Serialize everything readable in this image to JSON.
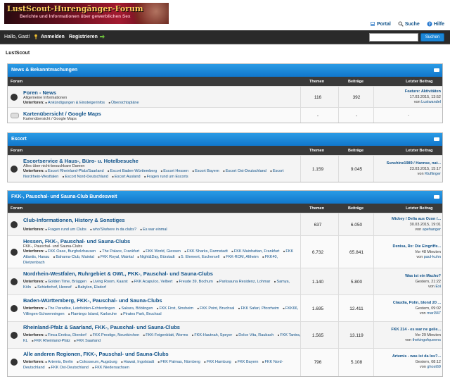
{
  "logo": {
    "title": "LustScout-Hurengänger-Forum",
    "subtitle": "Berichte und Informationen über gewerblichen Sex"
  },
  "toplinks": [
    {
      "label": "Portal",
      "icon": "portal-icon"
    },
    {
      "label": "Suche",
      "icon": "search-icon"
    },
    {
      "label": "Hilfe",
      "icon": "help-icon"
    }
  ],
  "nav": {
    "hello": "Hallo, Gast!",
    "login": "Anmelden",
    "register": "Registrieren",
    "search_btn": "Suchen",
    "search_value": ""
  },
  "site_label": "LustScout",
  "columns": {
    "forum": "Forum",
    "themen": "Themen",
    "beitraege": "Beiträge",
    "letzter": "Letzter Beitrag"
  },
  "categories": [
    {
      "title": "News & Bekanntmachungen",
      "forums": [
        {
          "title": "Foren - News",
          "desc": "Allgemeine Informationen",
          "subs_label": "Unterforen:",
          "subs": [
            "Ankündigungen & Einsteigerinfos",
            "Übersichtspläne"
          ],
          "themen": "116",
          "beitraege": "392",
          "last_title": "Feature: Aktivitäten",
          "last_date": "17.03.2015, 13:52",
          "last_by": "von",
          "last_user": "Lustwandel"
        },
        {
          "title": "Kartenübersicht / Google Maps",
          "desc": "Kartenübersicht / Google Maps",
          "subs_label": "",
          "subs": [],
          "themen": "-",
          "beitraege": "-",
          "last_title": "",
          "last_date": "-",
          "last_by": "",
          "last_user": ""
        }
      ]
    },
    {
      "title": "Escort",
      "forums": [
        {
          "title": "Escortservice & Haus-, Büro- u. Hotelbesuche",
          "desc": "Alles über nicht-besuchbare Damen",
          "subs_label": "Unterforen:",
          "subs": [
            "Escort Rheinland-Pfalz/Saarland",
            "Escort Baden-Württemberg",
            "Escort Hessen",
            "Escort Bayern",
            "Escort Ost-Deutschland",
            "Escort Nordrhein-Westfalen",
            "Escort Nord-Deutschland",
            "Escort Ausland",
            "Fragen rund um Escorts"
          ],
          "themen": "1.159",
          "beitraege": "9.045",
          "last_title": "Sunshine1989 / Hannse, nat...",
          "last_date": "23.03.2015, 15:17",
          "last_by": "von",
          "last_user": "Kluflinger"
        }
      ]
    },
    {
      "title": "FKK-, Pauschal- und Sauna-Club Bundesweit",
      "forums": [
        {
          "title": "Club-Informationen, History & Sonstiges",
          "desc": "",
          "subs_label": "Unterforen:",
          "subs": [
            "Fragen rund um Clubs",
            "who'S/where in da clubs?",
            "Es war einmal"
          ],
          "themen": "637",
          "beitraege": "6.050",
          "last_title": "Mickey / Delia aus Ozon /...",
          "last_date": "30.03.2015, 19:01",
          "last_by": "von",
          "last_user": "apehanger"
        },
        {
          "title": "Hessen, FKK-, Pauschal- und Sauna-Clubs",
          "desc": "FKK-, Pauschal- und Sauna-Clubs",
          "subs_label": "Unterforen:",
          "subs": [
            "FKK Oase, Burgholzhausen",
            "The Palace, Frankfurt",
            "FKK World, Giessen",
            "FKK Sharks, Darmstadt",
            "FKK Mainhattan, Frankfurt",
            "FKK Atlantis, Hanau",
            "Bahama-Club, Maintal",
            "FKK Royal, Maintal",
            "Night&Day, Bürstadt",
            "5. Element, Eschersell",
            "FKK-ROM, Altheim",
            "FKK40, Dietzenbach"
          ],
          "themen": "6.732",
          "beitraege": "65.841",
          "last_title": "Denisa, Re: Die Eingriffe...",
          "last_date": "Vor 48 Minuten",
          "last_by": "von",
          "last_user": "paul-kuhn"
        },
        {
          "title": "Nordrhein-Westfalen, Ruhrgebiet & OWL, FKK-, Pauschal- und Sauna-Clubs",
          "desc": "",
          "subs_label": "Unterforen:",
          "subs": [
            "Golden Time, Brüggen",
            "Living Room, Kaarst",
            "FKK Acapulco, Velbert",
            "Freude 39, Bochum",
            "Parksauna Residenz, Lohmar",
            "Samya, Köln",
            "Schieferhof, Hennef",
            "Babylon, Elsdorf"
          ],
          "themen": "1.140",
          "beitraege": "5.800",
          "last_title": "Was ist ein Macho?",
          "last_date": "Gestern, 21:22",
          "last_by": "von",
          "last_user": "Exi"
        },
        {
          "title": "Baden-Württemberg, FKK-, Pauschal- und Sauna-Clubs",
          "desc": "",
          "subs_label": "Unterforen:",
          "subs": [
            "The Paradise, Leinfelden-Echterdingen",
            "Sakura, Böblingen",
            "FKK First, Sinsheim",
            "FKK Point, Bruchsal",
            "FKK Safari, Pforzheim",
            "FKK66, Villingen-Schwenningen",
            "Flamingo Island, Karlsruhe",
            "Pirates Park, Bruchsal"
          ],
          "themen": "1.695",
          "beitraege": "12.411",
          "last_title": "Claudia, Polin, blond 20 ...",
          "last_date": "Gestern, 09:02",
          "last_by": "von",
          "last_user": "marl347"
        },
        {
          "title": "Rheinland-Pfalz & Saarland, FKK-, Pauschal- und Sauna-Clubs",
          "desc": "",
          "subs_label": "Unterforen:",
          "subs": [
            "Finca Erotica, Dierdorf",
            "FKK Prestige, Neunkirchen",
            "FKK-Feigenblatt, Worms",
            "FKK-Hautnah, Speyer",
            "Dolce Vita, Raubach",
            "FKK Tantra, KL",
            "FKK Rheinland-Pfalz",
            "FKK Saarland"
          ],
          "themen": "1.565",
          "beitraege": "13.119",
          "last_title": "FKK 214 - es war ne geile...",
          "last_date": "Vor 29 Minuten",
          "last_by": "von",
          "last_user": "thekingofqueens"
        },
        {
          "title": "Alle anderen Regionen, FKK-, Pauschal- und Sauna-Clubs",
          "desc": "",
          "subs_label": "Unterforen:",
          "subs": [
            "Artemis, Berlin",
            "Colosseum, Augsburg",
            "Hawaii, Ingolstadt",
            "FKK Palmas, Nürnberg",
            "FKK Hamburg",
            "FKK Bayern",
            "FKK Nord-Deutschland",
            "FKK Ost-Deutschland",
            "FKK Niedersachsen"
          ],
          "themen": "796",
          "beitraege": "5.108",
          "last_title": "Artemis - was ist da los?...",
          "last_date": "Gestern, 08:12",
          "last_by": "von",
          "last_user": "ghost69"
        }
      ]
    }
  ]
}
